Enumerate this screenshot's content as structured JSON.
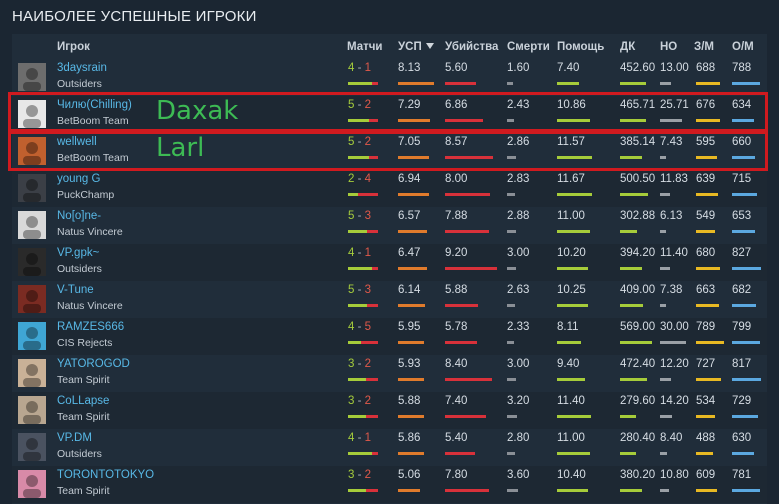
{
  "title": "НАИБОЛЕЕ УСПЕШНЫЕ ИГРОКИ",
  "headers": {
    "player": "Игрок",
    "matches": "Матчи",
    "usp": "УСП",
    "kills": "Убийства",
    "deaths": "Смерти",
    "assists": "Помощь",
    "dk": "ДК",
    "no": "НО",
    "gm": "З/М",
    "om": "О/М"
  },
  "sort_column": "usp",
  "colors": {
    "usp_bar": "#e07b2c",
    "kills_bar": "#d8313a",
    "deaths_bar": "#8a8f96",
    "assists_bar": "#a6cc3a",
    "dk_bar": "#a6cc3a",
    "no_bar": "#9aa0a6",
    "gm_bar": "#e8b923",
    "om_bar": "#5ba8e0",
    "highlight": "#d01a1f",
    "annotation": "#3dbb54"
  },
  "rows": [
    {
      "name": "3daysrain",
      "team": "Outsiders",
      "wins": "4",
      "losses": "1",
      "usp": "8.13",
      "kills": "5.60",
      "deaths": "1.60",
      "assists": "7.40",
      "dk": "452.60",
      "no": "13.00",
      "gm": "688",
      "om": "788"
    },
    {
      "name": "Чилю(Chilling)",
      "team": "BetBoom Team",
      "wins": "5",
      "losses": "2",
      "usp": "7.29",
      "kills": "6.86",
      "deaths": "2.43",
      "assists": "10.86",
      "dk": "465.71",
      "no": "25.71",
      "gm": "676",
      "om": "634"
    },
    {
      "name": "wellwell",
      "team": "BetBoom Team",
      "wins": "5",
      "losses": "2",
      "usp": "7.05",
      "kills": "8.57",
      "deaths": "2.86",
      "assists": "11.57",
      "dk": "385.14",
      "no": "7.43",
      "gm": "595",
      "om": "660"
    },
    {
      "name": "young G",
      "team": "PuckChamp",
      "wins": "2",
      "losses": "4",
      "usp": "6.94",
      "kills": "8.00",
      "deaths": "2.83",
      "assists": "11.67",
      "dk": "500.50",
      "no": "11.83",
      "gm": "639",
      "om": "715"
    },
    {
      "name": "No[o]ne-",
      "team": "Natus Vincere",
      "wins": "5",
      "losses": "3",
      "usp": "6.57",
      "kills": "7.88",
      "deaths": "2.88",
      "assists": "11.00",
      "dk": "302.88",
      "no": "6.13",
      "gm": "549",
      "om": "653"
    },
    {
      "name": "VP.gpk~",
      "team": "Outsiders",
      "wins": "4",
      "losses": "1",
      "usp": "6.47",
      "kills": "9.20",
      "deaths": "3.00",
      "assists": "10.20",
      "dk": "394.20",
      "no": "11.40",
      "gm": "680",
      "om": "827"
    },
    {
      "name": "V-Tune",
      "team": "Natus Vincere",
      "wins": "5",
      "losses": "3",
      "usp": "6.14",
      "kills": "5.88",
      "deaths": "2.63",
      "assists": "10.25",
      "dk": "409.00",
      "no": "7.38",
      "gm": "663",
      "om": "682"
    },
    {
      "name": "RAMZES666",
      "team": "CIS Rejects",
      "wins": "4",
      "losses": "5",
      "usp": "5.95",
      "kills": "5.78",
      "deaths": "2.33",
      "assists": "8.11",
      "dk": "569.00",
      "no": "30.00",
      "gm": "789",
      "om": "799"
    },
    {
      "name": "YATOROGOD",
      "team": "Team Spirit",
      "wins": "3",
      "losses": "2",
      "usp": "5.93",
      "kills": "8.40",
      "deaths": "3.00",
      "assists": "9.40",
      "dk": "472.40",
      "no": "12.20",
      "gm": "727",
      "om": "817"
    },
    {
      "name": "CoLLapse",
      "team": "Team Spirit",
      "wins": "3",
      "losses": "2",
      "usp": "5.88",
      "kills": "7.40",
      "deaths": "3.20",
      "assists": "11.40",
      "dk": "279.60",
      "no": "14.20",
      "gm": "534",
      "om": "729"
    },
    {
      "name": "VP.DM",
      "team": "Outsiders",
      "wins": "4",
      "losses": "1",
      "usp": "5.86",
      "kills": "5.40",
      "deaths": "2.80",
      "assists": "11.00",
      "dk": "280.40",
      "no": "8.40",
      "gm": "488",
      "om": "630"
    },
    {
      "name": "TORONTOTOKYO",
      "team": "Team Spirit",
      "wins": "3",
      "losses": "2",
      "usp": "5.06",
      "kills": "7.80",
      "deaths": "3.60",
      "assists": "10.40",
      "dk": "380.20",
      "no": "10.80",
      "gm": "609",
      "om": "781"
    }
  ],
  "annotations": [
    {
      "text": "Daxak",
      "row": 1
    },
    {
      "text": "Larl",
      "row": 2
    }
  ]
}
